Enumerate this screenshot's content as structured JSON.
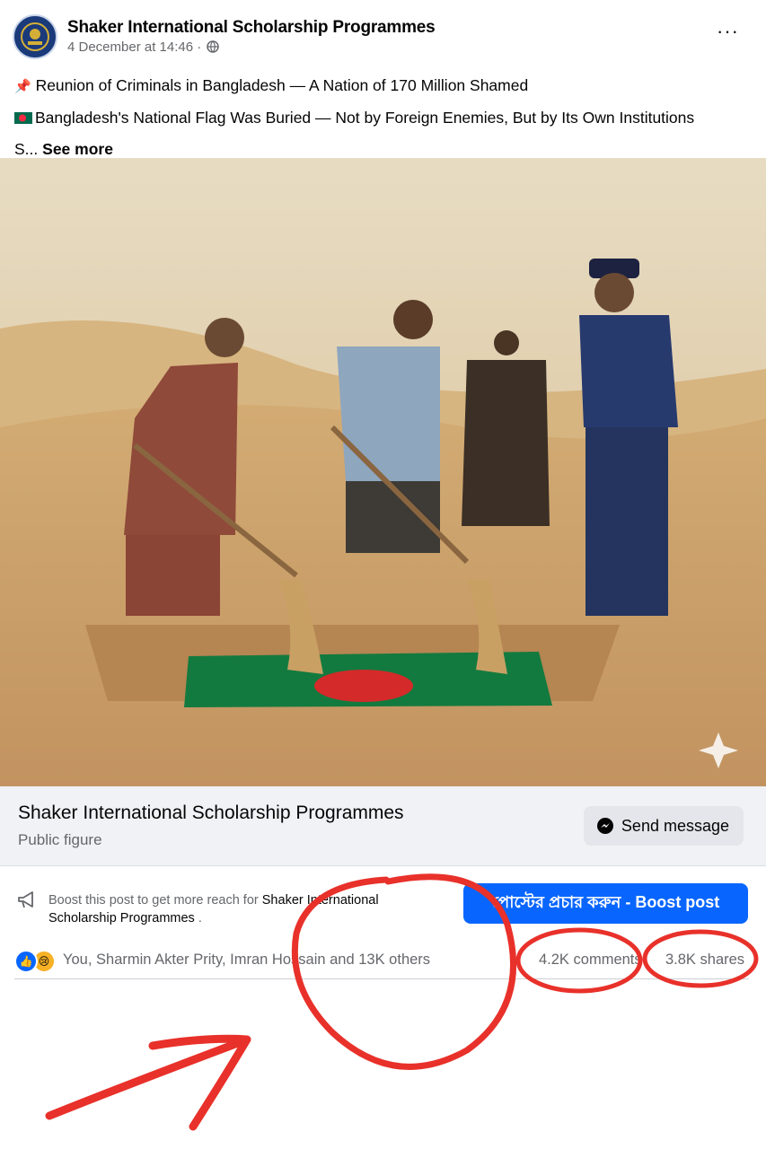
{
  "post": {
    "page_name": "Shaker International Scholarship Programmes",
    "timestamp": "4 December at 14:46 ·",
    "audience_icon": "globe-icon",
    "more_icon": "more-options-icon",
    "more_label": "···",
    "caption_line1": "Reunion of Criminals in Bangladesh — A Nation of 170 Million Shamed",
    "caption_line2": "Bangladesh's National Flag Was Buried — Not by Foreign Enemies, But by Its Own Institutions",
    "caption_line3": "S...",
    "see_more": "See more"
  },
  "cta": {
    "page_name": "Shaker International Scholarship Programmes",
    "category": "Public figure",
    "send_label": "Send message"
  },
  "boost": {
    "text_prefix": "Boost this post to get more reach for",
    "text_page": "Shaker International Scholarship Programmes",
    "text_suffix": ".",
    "button_label": "পোস্টের প্রচার করুন - Boost post"
  },
  "stats": {
    "reactions": [
      "like",
      "sad"
    ],
    "names": "You, Sharmin Akter Prity, Imran Hossain and 13K others",
    "comments": "4.2K comments",
    "shares": "3.8K shares"
  },
  "colors": {
    "brand_blue": "#0866ff",
    "annotation_red": "#e8312a",
    "secondary_text": "#65676b"
  }
}
